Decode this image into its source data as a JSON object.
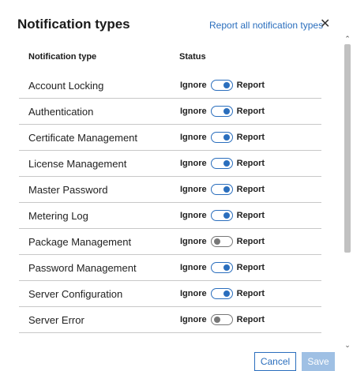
{
  "dialog": {
    "title": "Notification types",
    "report_all_label": "Report all notification types",
    "close_glyph": "✕"
  },
  "table": {
    "headers": {
      "type": "Notification type",
      "status": "Status"
    },
    "ignore_label": "Ignore",
    "report_label": "Report",
    "rows": [
      {
        "name": "Account Locking",
        "report": true
      },
      {
        "name": "Authentication",
        "report": true
      },
      {
        "name": "Certificate Management",
        "report": true
      },
      {
        "name": "License Management",
        "report": true
      },
      {
        "name": "Master Password",
        "report": true
      },
      {
        "name": "Metering Log",
        "report": true
      },
      {
        "name": "Package Management",
        "report": false
      },
      {
        "name": "Password Management",
        "report": true
      },
      {
        "name": "Server Configuration",
        "report": true
      },
      {
        "name": "Server Error",
        "report": false
      }
    ]
  },
  "footer": {
    "cancel_label": "Cancel",
    "save_label": "Save"
  },
  "colors": {
    "accent": "#2a6ebd",
    "disabled_button": "#9fc0e4"
  },
  "icons": {
    "close": "close-icon",
    "scroll_up": "chevron-up-icon",
    "scroll_down": "chevron-down-icon"
  }
}
